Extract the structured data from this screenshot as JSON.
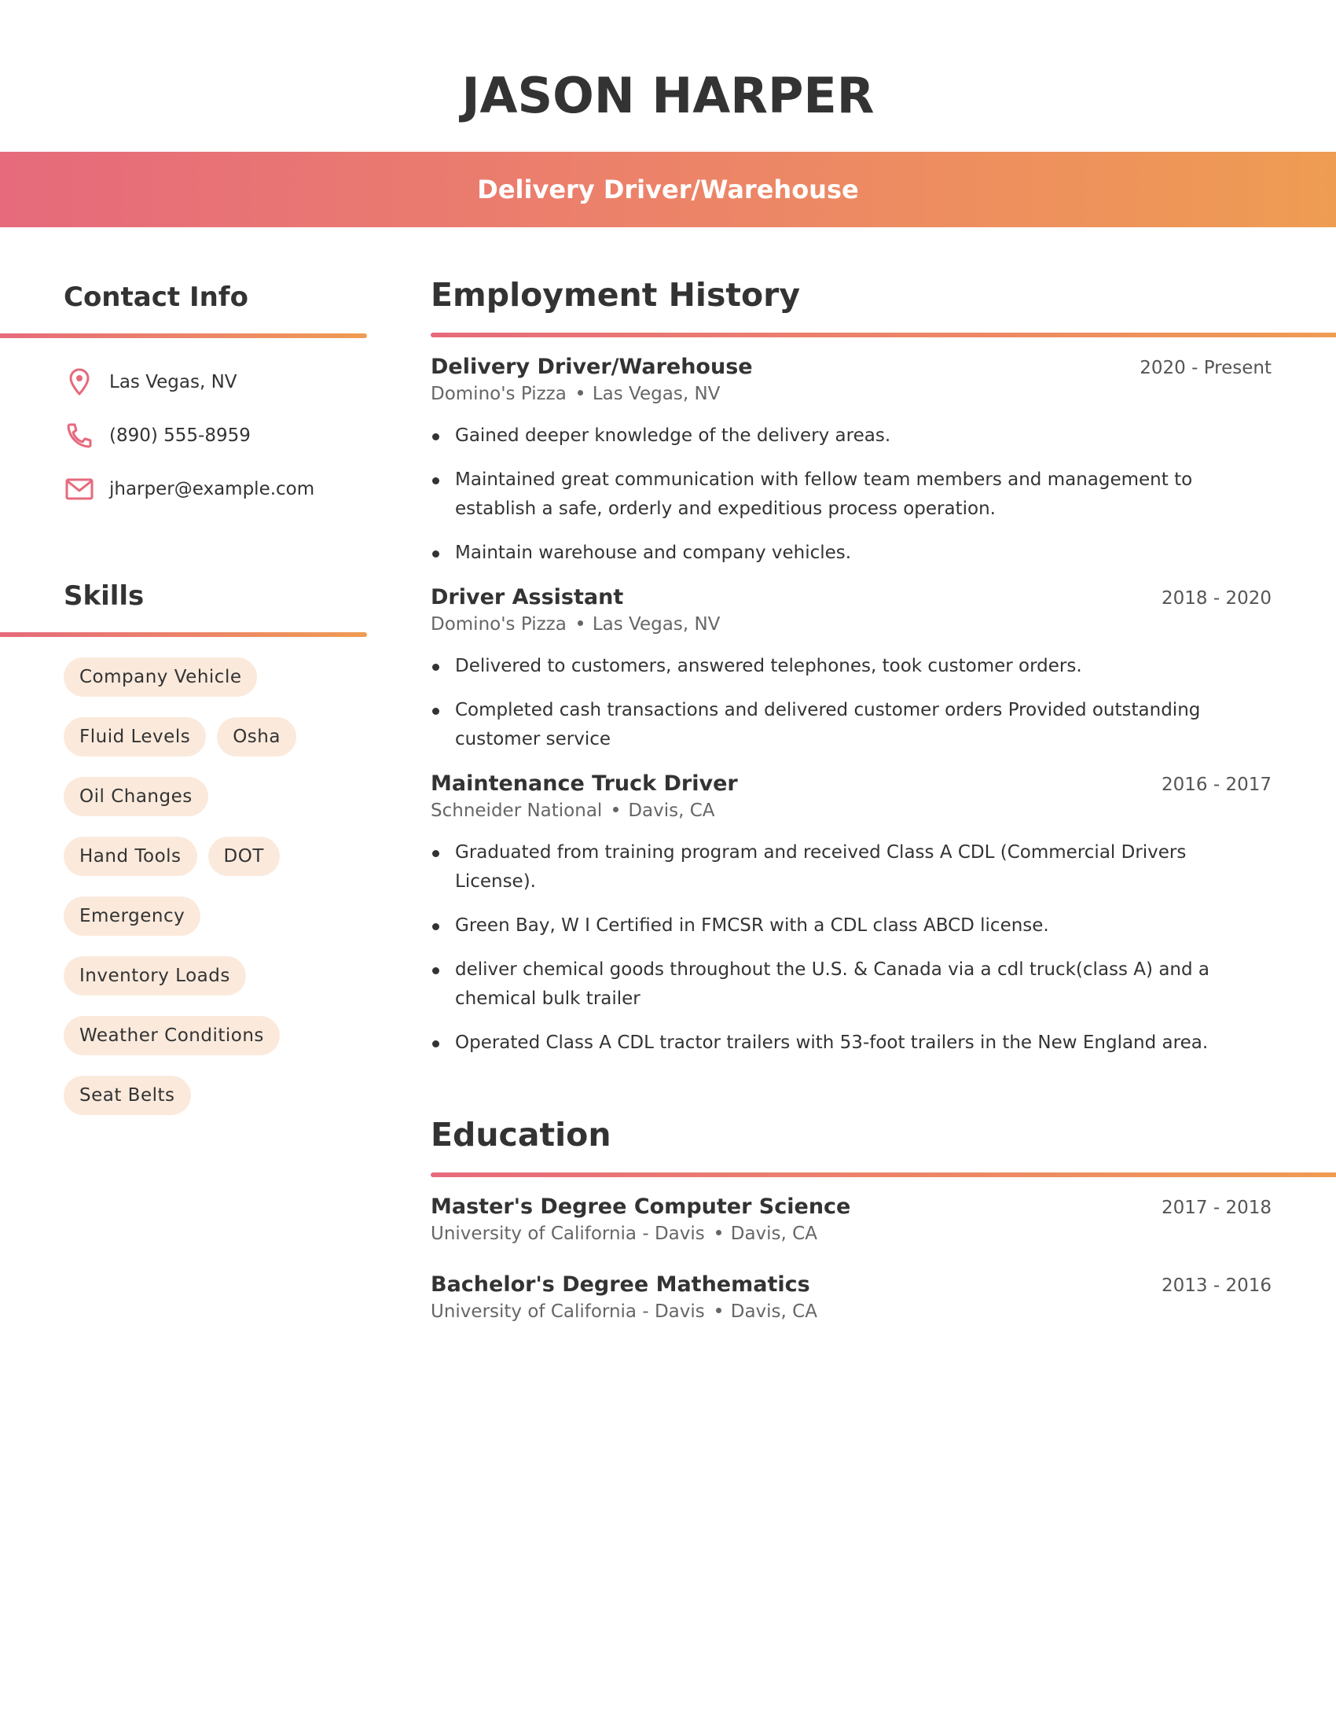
{
  "header": {
    "name": "JASON HARPER",
    "job_title": "Delivery Driver/Warehouse"
  },
  "colors": {
    "gradient_start": "#e66a7c",
    "gradient_end": "#ef9c53",
    "chip_bg": "#fbeadc",
    "text": "#333333",
    "icon": "#e66a7c"
  },
  "contact": {
    "title": "Contact Info",
    "items": [
      {
        "icon": "location-pin-icon",
        "text": "Las Vegas, NV"
      },
      {
        "icon": "phone-icon",
        "text": "(890) 555-8959"
      },
      {
        "icon": "email-icon",
        "text": "jharper@example.com"
      }
    ]
  },
  "skills": {
    "title": "Skills",
    "items": [
      "Company Vehicle",
      "Fluid Levels",
      "Osha",
      "Oil Changes",
      "Hand Tools",
      "DOT",
      "Emergency",
      "Inventory Loads",
      "Weather Conditions",
      "Seat Belts"
    ]
  },
  "employment": {
    "title": "Employment History",
    "entries": [
      {
        "title": "Delivery Driver/Warehouse",
        "dates": "2020 - Present",
        "company": "Domino's Pizza",
        "location": "Las Vegas, NV",
        "bullets": [
          "Gained deeper knowledge of the delivery areas.",
          "Maintained great communication with fellow team members and management to establish a safe, orderly and expeditious process operation.",
          "Maintain warehouse and company vehicles."
        ]
      },
      {
        "title": "Driver Assistant",
        "dates": "2018 - 2020",
        "company": "Domino's Pizza",
        "location": "Las Vegas, NV",
        "bullets": [
          "Delivered to customers, answered telephones, took customer orders.",
          "Completed cash transactions and delivered customer orders Provided outstanding customer service"
        ]
      },
      {
        "title": "Maintenance Truck Driver",
        "dates": "2016 - 2017",
        "company": "Schneider National",
        "location": "Davis, CA",
        "bullets": [
          "Graduated from training program and received Class A CDL (Commercial Drivers License).",
          "Green Bay, W I Certified in FMCSR with a CDL class ABCD license.",
          "deliver chemical goods throughout the U.S. & Canada via a cdl truck(class A) and a chemical bulk trailer",
          "Operated Class A CDL tractor trailers with 53-foot trailers in the New England area."
        ]
      }
    ]
  },
  "education": {
    "title": "Education",
    "entries": [
      {
        "title": "Master's Degree Computer Science",
        "dates": "2017 - 2018",
        "school": "University of California - Davis",
        "location": "Davis, CA"
      },
      {
        "title": "Bachelor's Degree Mathematics",
        "dates": "2013 - 2016",
        "school": "University of California - Davis",
        "location": "Davis, CA"
      }
    ]
  }
}
